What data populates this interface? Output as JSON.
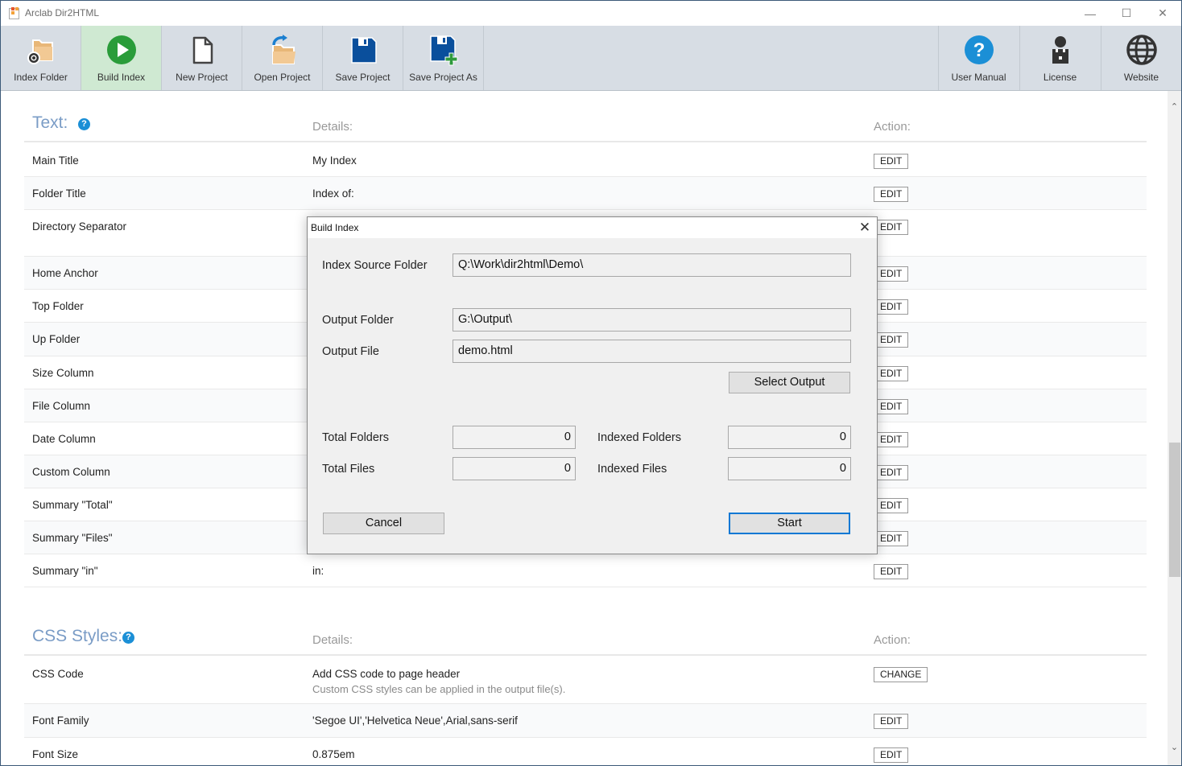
{
  "window": {
    "title": "Arclab Dir2HTML",
    "controls": {
      "minimize": "—",
      "maximize": "☐",
      "close": "✕"
    }
  },
  "toolbar": {
    "left": [
      {
        "label": "Index Folder",
        "icon": "folder-target-icon"
      },
      {
        "label": "Build Index",
        "icon": "play-icon",
        "active": true
      },
      {
        "label": "New Project",
        "icon": "new-document-icon"
      },
      {
        "label": "Open Project",
        "icon": "open-folder-icon"
      },
      {
        "label": "Save Project",
        "icon": "floppy-disk-icon"
      },
      {
        "label": "Save Project As",
        "icon": "floppy-disk-plus-icon"
      }
    ],
    "right": [
      {
        "label": "User Manual",
        "icon": "help-circle-icon"
      },
      {
        "label": "License",
        "icon": "license-person-icon"
      },
      {
        "label": "Website",
        "icon": "globe-icon"
      }
    ]
  },
  "colors": {
    "accent_title": "#7a9cc6",
    "help_blue": "#1b8fd6",
    "active_tab": "#cfe9d2",
    "play_green": "#2a9c3a",
    "floppy_blue": "#0a4f9c",
    "default_button_border": "#0a78d4"
  },
  "text_section": {
    "title": "Text:",
    "help": "?",
    "details_header": "Details:",
    "action_header": "Action:",
    "rows": [
      {
        "label": "Main Title",
        "detail": "My Index",
        "action": "EDIT"
      },
      {
        "label": "Folder Title",
        "detail": "Index of:",
        "action": "EDIT"
      },
      {
        "label": "Directory Separator",
        "detail": "",
        "action": "EDIT"
      },
      {
        "label": "Home Anchor",
        "detail": "",
        "action": "EDIT"
      },
      {
        "label": "Top Folder",
        "detail": "",
        "action": "EDIT"
      },
      {
        "label": "Up Folder",
        "detail": "",
        "action": "EDIT"
      },
      {
        "label": "Size Column",
        "detail": "",
        "action": "EDIT"
      },
      {
        "label": "File Column",
        "detail": "",
        "action": "EDIT"
      },
      {
        "label": "Date Column",
        "detail": "",
        "action": "EDIT"
      },
      {
        "label": "Custom Column",
        "detail": "",
        "action": "EDIT"
      },
      {
        "label": "Summary \"Total\"",
        "detail": "",
        "action": "EDIT"
      },
      {
        "label": "Summary \"Files\"",
        "detail": "",
        "action": "EDIT"
      },
      {
        "label": "Summary \"in\"",
        "detail": "in:",
        "action": "EDIT"
      }
    ]
  },
  "css_section": {
    "title": "CSS Styles:",
    "help": "?",
    "details_header": "Details:",
    "action_header": "Action:",
    "rows": [
      {
        "label": "CSS Code",
        "detail": "Add CSS code to page header",
        "sub": "Custom CSS styles can be applied in the output file(s).",
        "action": "CHANGE"
      },
      {
        "label": "Font Family",
        "detail": "'Segoe UI','Helvetica Neue',Arial,sans-serif",
        "action": "EDIT"
      },
      {
        "label": "Font Size",
        "detail": "0.875em",
        "action": "EDIT"
      }
    ]
  },
  "scrollbar": {
    "up": "⌃",
    "down": "⌄"
  },
  "dialog": {
    "title": "Build Index",
    "close": "✕",
    "source_label": "Index Source Folder",
    "source_value": "Q:\\Work\\dir2html\\Demo\\",
    "output_folder_label": "Output Folder",
    "output_folder_value": "G:\\Output\\",
    "output_file_label": "Output File",
    "output_file_value": "demo.html",
    "select_output_label": "Select Output",
    "total_folders_label": "Total Folders",
    "total_folders_value": "0",
    "indexed_folders_label": "Indexed Folders",
    "indexed_folders_value": "0",
    "total_files_label": "Total Files",
    "total_files_value": "0",
    "indexed_files_label": "Indexed Files",
    "indexed_files_value": "0",
    "cancel_label": "Cancel",
    "start_label": "Start"
  }
}
